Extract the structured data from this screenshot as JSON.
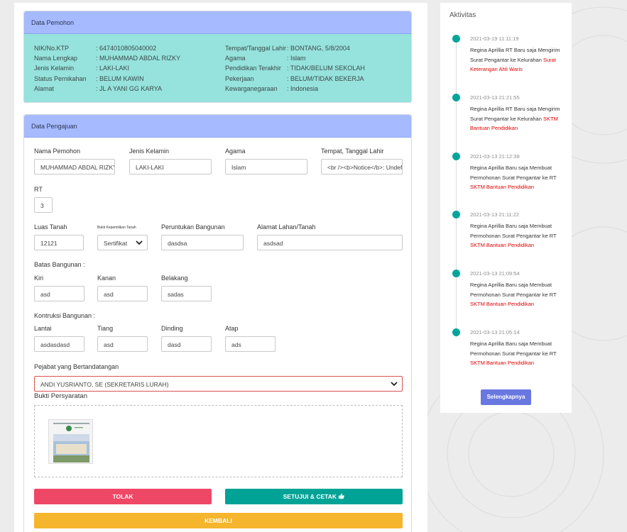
{
  "pemohon_panel": {
    "title": "Data Pemohon",
    "left": [
      {
        "label": "NIK/No.KTP",
        "value": ": 6474010805040002"
      },
      {
        "label": "Nama Lengkap",
        "value": ": MUHAMMAD ABDAL RIZKY"
      },
      {
        "label": "Jenis Kelamin",
        "value": ": LAKI-LAKI"
      },
      {
        "label": "Status Pernikahan",
        "value": ": BELUM KAWIN"
      },
      {
        "label": "Alamat",
        "value": ": JL A YANI GG KARYA"
      }
    ],
    "right": [
      {
        "label": "Tempat/Tanggal Lahir",
        "value": ": BONTANG, 5/8/2004"
      },
      {
        "label": "Agama",
        "value": ": Islam"
      },
      {
        "label": "Pendidikan Terakhir",
        "value": ": TIDAK/BELUM SEKOLAH"
      },
      {
        "label": "Pekerjaan",
        "value": ": BELUM/TIDAK BEKERJA"
      },
      {
        "label": "Kewarganegaraan",
        "value": ": Indonesia"
      }
    ]
  },
  "pengajuan_panel": {
    "title": "Data Pengajuan",
    "nama_pemohon": {
      "label": "Nama Pemohon",
      "value": "MUHAMMAD ABDAL RIZKY"
    },
    "jenis_kelamin": {
      "label": "Jenis Kelamin",
      "value": "LAKI-LAKI"
    },
    "agama": {
      "label": "Agama",
      "value": "Islam"
    },
    "ttl": {
      "label": "Tempat, Tanggal Lahir",
      "value": "<br /><b>Notice</b>:  Undefined"
    },
    "rt": {
      "label": "RT",
      "value": "3"
    },
    "luas_tanah": {
      "label": "Luas Tanah",
      "value": "12121"
    },
    "bukti_kepemilikan": {
      "label": "Bukti Kepemilikan Tanah",
      "value": "Sertifikat"
    },
    "peruntukan": {
      "label": "Peruntukan Bangunan",
      "value": "dasdsa"
    },
    "alamat_lahan": {
      "label": "Alamat Lahan/Tanah",
      "value": "asdsad"
    },
    "batas_title": "Batas Bangunan :",
    "kiri": {
      "label": "Kiri",
      "value": "asd"
    },
    "kanan": {
      "label": "Kanan",
      "value": "asd"
    },
    "belakang": {
      "label": "Belakang",
      "value": "sadas"
    },
    "kontruksi_title": "Kontruksi Bangunan :",
    "lantai": {
      "label": "Lantai",
      "value": "asdasdasd"
    },
    "tiang": {
      "label": "Tiang",
      "value": "asd"
    },
    "dinding": {
      "label": "Dinding",
      "value": "dasd"
    },
    "atap": {
      "label": "Atap",
      "value": "ads"
    },
    "pejabat": {
      "label": "Pejabat yang Bertandatangan",
      "value": "ANDI YUSRIANTO, SE (SEKRETARIS LURAH)"
    },
    "bukti_persyaratan": "Bukti Persyaratan"
  },
  "buttons": {
    "tolak": "TOLAK",
    "setujui": "SETUJUI & CETAK",
    "kembali": "KEMBALI"
  },
  "aktivitas": {
    "title": "Aktivitas",
    "items": [
      {
        "time": "2021-03-19 11:11:19",
        "text": "Regina Aprillia RT Baru saja Mengirim Surat Pengantar ke Kelurahan ",
        "highlight": "Surat Keterangan Ahli Waris"
      },
      {
        "time": "2021-03-13 21:21:55",
        "text": "Regina Aprillia RT Baru saja Mengirim Surat Pengantar ke Kelurahan ",
        "highlight": "SKTM Bantuan Pendidikan"
      },
      {
        "time": "2021-03-13 21:12:39",
        "text": "Regina Aprillia Baru saja Membuat Permohonan Surat Pengantar ke RT ",
        "highlight": "SKTM Bantuan Pendidikan"
      },
      {
        "time": "2021-03-13 21:11:22",
        "text": "Regina Aprillia Baru saja Membuat Permohonan Surat Pengantar ke RT ",
        "highlight": "SKTM Bantuan Pendidikan"
      },
      {
        "time": "2021-03-13 21:09:54",
        "text": "Regina Aprillia Baru saja Membuat Permohonan Surat Pengantar ke RT ",
        "highlight": "SKTM Bantuan Pendidikan"
      },
      {
        "time": "2021-03-13 21:05:14",
        "text": "Regina Aprillia Baru saja Membuat Permohonan Surat Pengantar ke RT ",
        "highlight": "SKTM Bantuan Pendidikan"
      }
    ],
    "more_label": "Selengkapnya"
  },
  "colors": {
    "header_blue": "#a5baff",
    "info_teal": "#96e2dc",
    "tolak": "#ef4766",
    "setujui": "#00a396",
    "kembali": "#f5b52c",
    "timeline_dot": "#00a69a",
    "more_button": "#6978e0",
    "highlight_red": "#e10000"
  }
}
